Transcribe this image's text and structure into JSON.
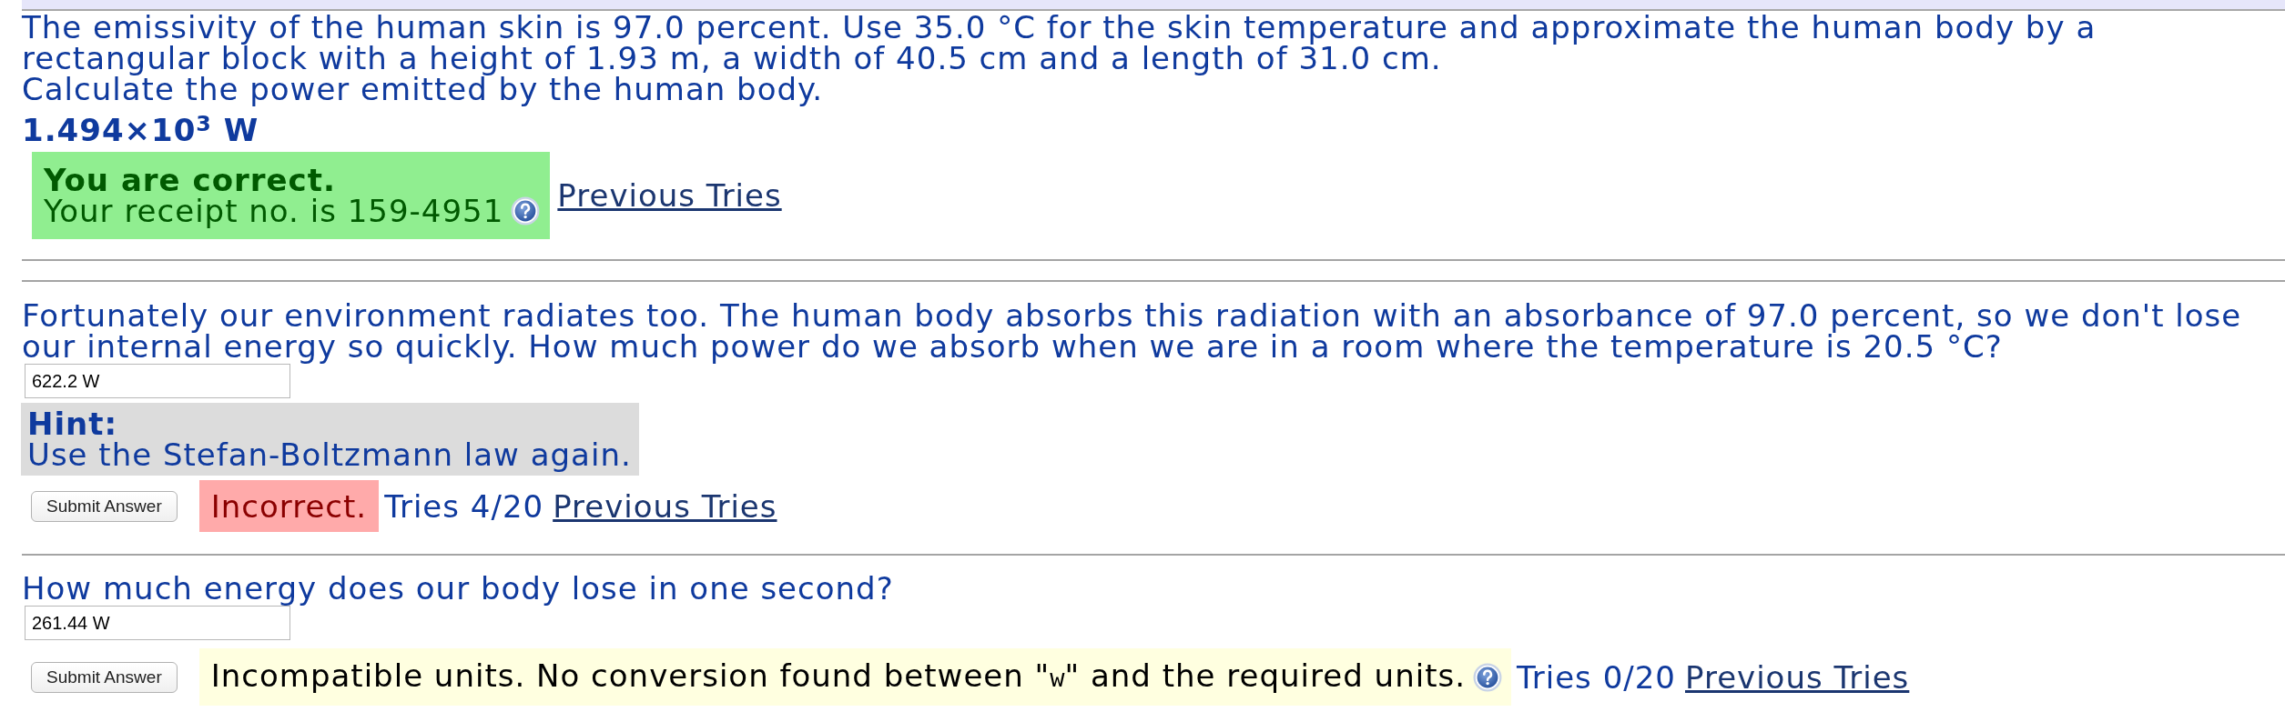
{
  "parts": [
    {
      "text_lines": [
        "The emissivity of the human skin is 97.0 percent. Use 35.0 °C for the skin temperature and approximate the human body by a rectangular block with a height of 1.93 m, a width of 40.5 cm and a length of 31.0 cm.",
        "Calculate the power emitted by the human body."
      ],
      "answer": "1.494×10$^{3}$ W",
      "status": {
        "kind": "correct",
        "title": "You are correct.",
        "text": "Your receipt no. is 159-4951"
      },
      "previous_tries": "Previous Tries"
    },
    {
      "text_lines": [
        "Fortunately our environment radiates too. The human body absorbs this radiation with an absorbance of 97.0 percent, so we don't lose our internal energy so quickly. How much power do we absorb when we are in a room where the temperature is 20.5 °C?"
      ],
      "input": {
        "value": "622.2 W"
      },
      "hint": {
        "title": "Hint:",
        "text": "Use the Stefan-Boltzmann law again."
      },
      "submit": "Submit Answer",
      "status": {
        "kind": "incorrect",
        "text": "Incorrect."
      },
      "tries": "Tries 4/20",
      "previous_tries": "Previous Tries"
    },
    {
      "text_lines": [
        "How much energy does our body lose in one second?"
      ],
      "input": {
        "value": "261.44 W"
      },
      "submit": "Submit Answer",
      "status": {
        "kind": "units",
        "segments": [
          {
            "kind": "plain",
            "text": "Incompatible units. No conversion found between \""
          },
          {
            "kind": "code",
            "text": "w"
          },
          {
            "kind": "plain",
            "text": "\" and the required units."
          }
        ]
      },
      "tries": "Tries 0/20",
      "previous_tries": "Previous Tries"
    }
  ]
}
